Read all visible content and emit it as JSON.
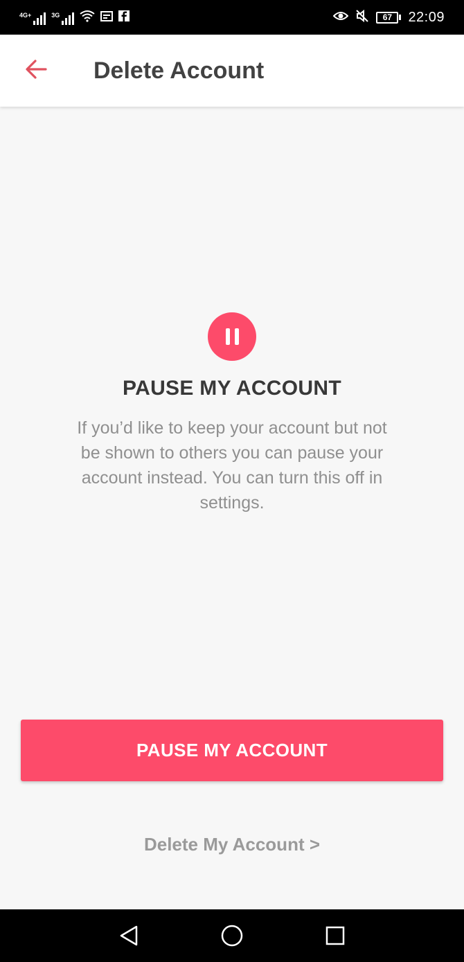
{
  "status_bar": {
    "network_1": "4G+",
    "network_2": "3G",
    "battery": "67",
    "time": "22:09",
    "icons": [
      "signal-icon",
      "signal-icon",
      "wifi-icon",
      "calendar-icon",
      "facebook-icon",
      "eye-icon",
      "mute-icon",
      "battery-icon"
    ]
  },
  "app_bar": {
    "back_icon": "back-arrow-icon",
    "title": "Delete Account"
  },
  "main": {
    "icon": "pause-icon",
    "heading": "PAUSE MY ACCOUNT",
    "description": "If you’d like to keep your account but not be shown to others you can pause your account instead. You can turn this off in settings.",
    "primary_button": "PAUSE MY ACCOUNT",
    "delete_link": "Delete My Account >"
  },
  "nav_bar": {
    "icons": [
      "back-triangle-icon",
      "home-circle-icon",
      "recents-square-icon"
    ]
  },
  "colors": {
    "accent": "#fd4b6a",
    "back_arrow": "#e0525f",
    "heading_text": "#383838",
    "body_text": "#8f8f8f",
    "background": "#f7f7f7"
  }
}
